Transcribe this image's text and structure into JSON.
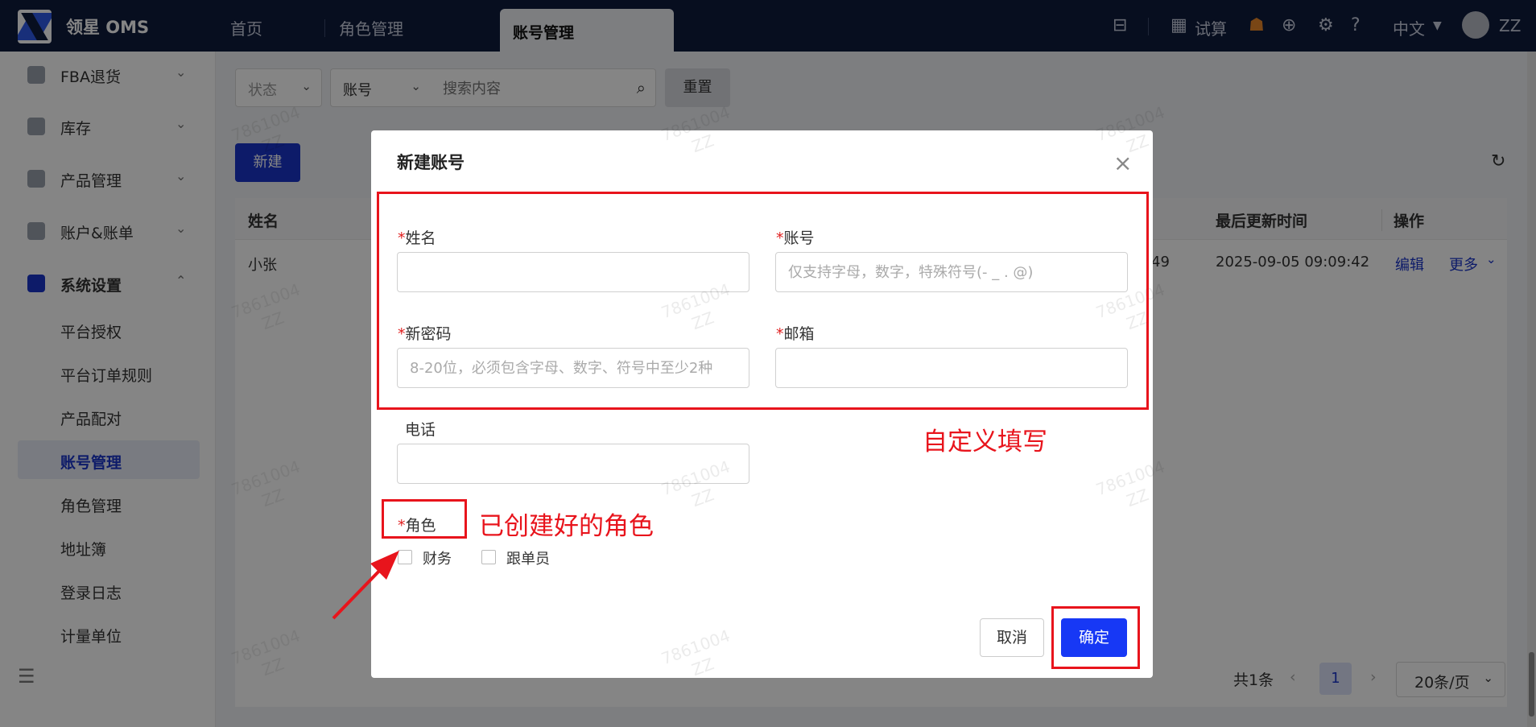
{
  "header": {
    "brand": "领星 OMS",
    "tabs": [
      "首页",
      "角色管理",
      "账号管理"
    ],
    "calc_label": "试算",
    "language": "中文",
    "user": "ZZ"
  },
  "sidebar": {
    "groups": [
      {
        "label": "FBA退货",
        "icon": "box-return-icon"
      },
      {
        "label": "库存",
        "icon": "warehouse-icon"
      },
      {
        "label": "产品管理",
        "icon": "bag-icon"
      },
      {
        "label": "账户&账单",
        "icon": "bill-icon"
      },
      {
        "label": "系统设置",
        "icon": "settings-hex-icon"
      }
    ],
    "sub_items": [
      "平台授权",
      "平台订单规则",
      "产品配对",
      "账号管理",
      "角色管理",
      "地址簿",
      "登录日志",
      "计量单位"
    ],
    "active_sub": "账号管理"
  },
  "filters": {
    "status_label": "状态",
    "account_label": "账号",
    "search_placeholder": "搜索内容",
    "reset_label": "重置"
  },
  "toolbar": {
    "new_label": "新建"
  },
  "table": {
    "columns": [
      "姓名",
      "最后更新时间",
      "操作"
    ],
    "rows": [
      {
        "name": "小张",
        "partial": "49",
        "updated": "2025-09-05 09:09:42",
        "edit": "编辑",
        "more": "更多"
      }
    ]
  },
  "pagination": {
    "total": "共1条",
    "current": "1",
    "size": "20条/页"
  },
  "watermark": {
    "line1": "7861004",
    "line2": "ZZ"
  },
  "modal": {
    "title": "新建账号",
    "fields": {
      "name_label": "姓名",
      "account_label": "账号",
      "account_placeholder": "仅支持字母，数字，特殊符号(- _ . @)",
      "password_label": "新密码",
      "password_placeholder": "8-20位，必须包含字母、数字、符号中至少2种",
      "email_label": "邮箱",
      "phone_label": "电话",
      "role_label": "角色"
    },
    "roles": [
      "财务",
      "跟单员"
    ],
    "cancel_label": "取消",
    "ok_label": "确定"
  },
  "annotations": {
    "custom_fill": "自定义填写",
    "created_roles": "已创建好的角色",
    "color": "#e8141c"
  }
}
